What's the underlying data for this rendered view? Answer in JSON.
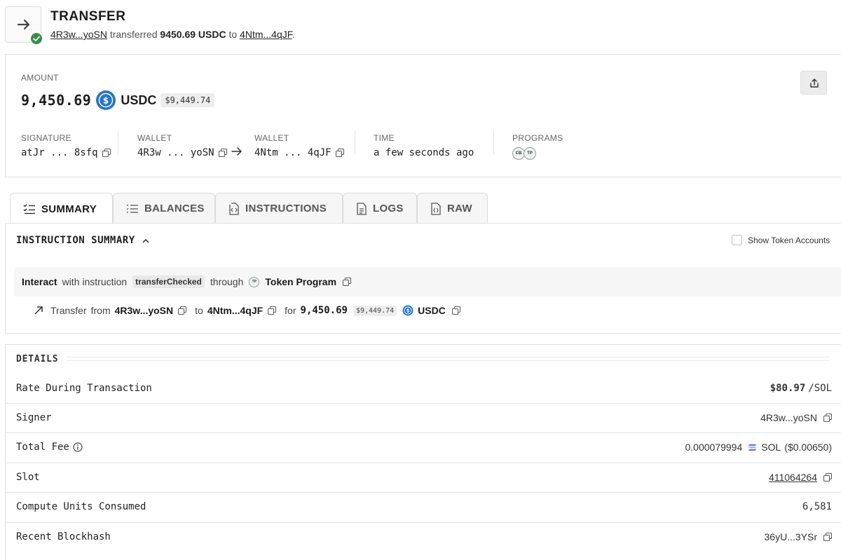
{
  "header": {
    "title": "TRANSFER",
    "from_short": "4R3w...yoSN",
    "verb": "transferred",
    "amount_text": "9450.69 USDC",
    "to_word": "to",
    "to_short": "4Ntm...4qJF",
    "period": "."
  },
  "amount": {
    "label": "AMOUNT",
    "value": "9,450.69",
    "token": "USDC",
    "usd": "$9,449.74"
  },
  "info": {
    "signature_label": "SIGNATURE",
    "signature": "atJr ... 8sfq",
    "wallet_from_label": "WALLET",
    "wallet_from": "4R3w ... yoSN",
    "wallet_to_label": "WALLET",
    "wallet_to": "4Ntm ... 4qJF",
    "time_label": "TIME",
    "time": "a few seconds ago",
    "programs_label": "PROGRAMS",
    "programs": [
      "CB",
      "TP"
    ]
  },
  "tabs": [
    {
      "label": "SUMMARY",
      "active": true
    },
    {
      "label": "BALANCES"
    },
    {
      "label": "INSTRUCTIONS"
    },
    {
      "label": "LOGS"
    },
    {
      "label": "RAW"
    }
  ],
  "instruction_summary": {
    "title": "INSTRUCTION SUMMARY",
    "show_token_accounts": "Show Token Accounts",
    "interact": "Interact",
    "with_instruction": "with instruction",
    "instruction_name": "transferChecked",
    "through": "through",
    "program_badge": "TP",
    "program_name": "Token Program",
    "transfer": {
      "word": "Transfer",
      "from_word": "from",
      "from": "4R3w...yoSN",
      "to_word": "to",
      "to": "4Ntm...4qJF",
      "for_word": "for",
      "amount": "9,450.69",
      "usd": "$9,449.74",
      "token": "USDC"
    }
  },
  "details": {
    "title": "DETAILS",
    "rate_label": "Rate During Transaction",
    "rate_value": "$80.97",
    "rate_unit": "/SOL",
    "signer_label": "Signer",
    "signer_value": "4R3w...yoSN",
    "fee_label": "Total Fee",
    "fee_value": "0.000079994",
    "fee_token": "SOL",
    "fee_usd": "($0.00650)",
    "slot_label": "Slot",
    "slot_value": "411064264",
    "cu_label": "Compute Units Consumed",
    "cu_value": "6,581",
    "blockhash_label": "Recent Blockhash",
    "blockhash_value": "36yU...3YSr"
  },
  "colors": {
    "success_green": "#3a8e4c",
    "usdc_blue": "#2775ca"
  }
}
